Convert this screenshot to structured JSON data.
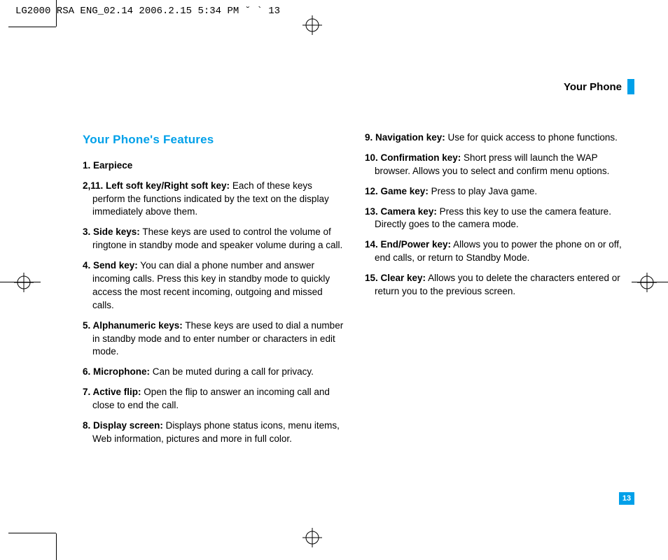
{
  "header": {
    "file_info": "LG2000 RSA ENG_02.14  2006.2.15 5:34 PM  ˘  ` 13"
  },
  "section": {
    "label": "Your Phone"
  },
  "title": "Your Phone's Features",
  "left_items": [
    {
      "num": "1.",
      "name": "Earpiece",
      "desc": ""
    },
    {
      "num": "2,11.",
      "name": "Left soft key/Right soft key:",
      "desc": " Each of these keys perform the functions indicated by the text on the display immediately above them."
    },
    {
      "num": "3.",
      "name": "Side keys:",
      "desc": " These keys are used to control the volume of ringtone in standby mode and speaker volume during a call."
    },
    {
      "num": "4.",
      "name": "Send key:",
      "desc": " You can dial a phone number and answer incoming  calls. Press this key in standby mode to quickly access the most recent incoming, outgoing and missed calls."
    },
    {
      "num": "5.",
      "name": "Alphanumeric keys:",
      "desc": " These keys are used to dial a number in standby mode and to enter number or characters in edit mode."
    },
    {
      "num": "6.",
      "name": "Microphone:",
      "desc": " Can be muted during a call for privacy."
    },
    {
      "num": "7.",
      "name": "Active flip:",
      "desc": " Open the flip to answer an incoming call and close to end the call."
    },
    {
      "num": "8.",
      "name": "Display screen:",
      "desc": " Displays phone status icons, menu items, Web information, pictures and more in full color."
    }
  ],
  "right_items": [
    {
      "num": "9.",
      "name": "Navigation key:",
      "desc": " Use for quick access to phone functions."
    },
    {
      "num": "10.",
      "name": "Confirmation key:",
      "desc": " Short press will launch the WAP browser. Allows you to select and confirm menu options."
    },
    {
      "num": "12.",
      "name": "Game key:",
      "desc": " Press to play Java game."
    },
    {
      "num": "13.",
      "name": "Camera key:",
      "desc": " Press this key to use the camera feature. Directly goes to the camera mode."
    },
    {
      "num": "14.",
      "name": "End/Power key:",
      "desc": " Allows you to power the phone on or off, end calls, or return to Standby Mode."
    },
    {
      "num": "15.",
      "name": "Clear key:",
      "desc": " Allows you to delete the characters entered or return you to the previous screen."
    }
  ],
  "page_number": "13"
}
